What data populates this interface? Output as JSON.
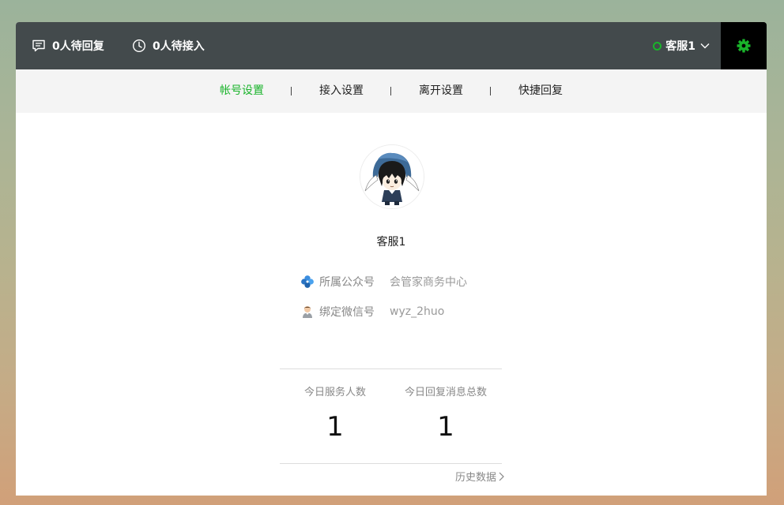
{
  "topbar": {
    "pending_reply": "0人待回复",
    "pending_access": "0人待接入",
    "agent_name": "客服1",
    "status_color": "#19b32a"
  },
  "subnav": {
    "tabs": [
      {
        "label": "帐号设置",
        "active": true
      },
      {
        "label": "接入设置",
        "active": false
      },
      {
        "label": "离开设置",
        "active": false
      },
      {
        "label": "快捷回复",
        "active": false
      }
    ]
  },
  "profile": {
    "name": "客服1",
    "info": [
      {
        "icon": "clover-icon",
        "label": "所属公众号",
        "value": "会管家商务中心"
      },
      {
        "icon": "person-icon",
        "label": "绑定微信号",
        "value": "wyz_2huo"
      }
    ]
  },
  "stats": {
    "served_label": "今日服务人数",
    "served_value": "1",
    "replies_label": "今日回复消息总数",
    "replies_value": "1",
    "history_label": "历史数据"
  },
  "colors": {
    "accent": "#19b32a",
    "topbar_bg": "#434a4c",
    "subnav_bg": "#f4f4f4"
  }
}
